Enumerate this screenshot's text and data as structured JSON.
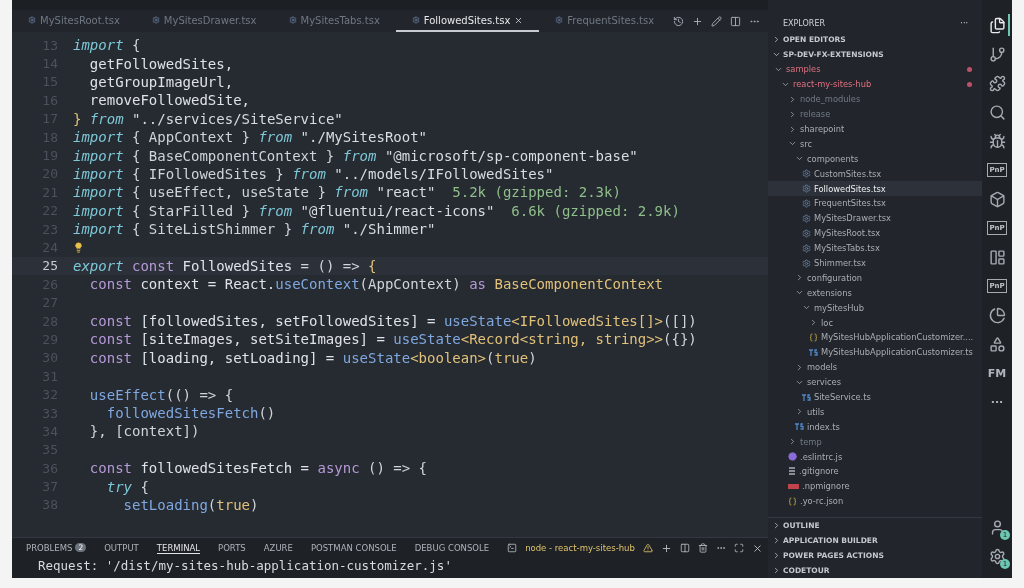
{
  "editor_tabs": [
    {
      "label": "MySitesRoot.tsx",
      "selected": false
    },
    {
      "label": "MySitesDrawer.tsx",
      "selected": false
    },
    {
      "label": "MySitesTabs.tsx",
      "selected": false
    },
    {
      "label": "FollowedSites.tsx",
      "selected": true
    },
    {
      "label": "FrequentSites.tsx",
      "selected": false
    }
  ],
  "code": {
    "lines": [
      {
        "number": "13",
        "tokens": [
          {
            "kind": "kw",
            "text": "import"
          },
          {
            "kind": "p",
            "text": " {"
          }
        ]
      },
      {
        "number": "14",
        "tokens": [
          {
            "kind": "v",
            "text": "  getFollowedSites,"
          }
        ]
      },
      {
        "number": "15",
        "tokens": [
          {
            "kind": "v",
            "text": "  getGroupImageUrl,"
          }
        ]
      },
      {
        "number": "16",
        "tokens": [
          {
            "kind": "v",
            "text": "  removeFollowedSite,"
          }
        ]
      },
      {
        "number": "17",
        "tokens": [
          {
            "kind": "t",
            "text": "}"
          },
          {
            "kind": "kw",
            "text": " from "
          },
          {
            "kind": "s",
            "text": "\"../services/SiteService\""
          }
        ]
      },
      {
        "number": "18",
        "tokens": [
          {
            "kind": "kw",
            "text": "import"
          },
          {
            "kind": "p",
            "text": " { AppContext } "
          },
          {
            "kind": "kw",
            "text": "from "
          },
          {
            "kind": "s",
            "text": "\"./MySitesRoot\""
          }
        ]
      },
      {
        "number": "19",
        "tokens": [
          {
            "kind": "kw",
            "text": "import"
          },
          {
            "kind": "p",
            "text": " { BaseComponentContext } "
          },
          {
            "kind": "kw",
            "text": "from "
          },
          {
            "kind": "s",
            "text": "\"@microsoft/sp-component-base\""
          }
        ]
      },
      {
        "number": "20",
        "tokens": [
          {
            "kind": "kw",
            "text": "import"
          },
          {
            "kind": "p",
            "text": " { IFollowedSites } "
          },
          {
            "kind": "kw",
            "text": "from "
          },
          {
            "kind": "s",
            "text": "\"../models/IFollowedSites\""
          }
        ]
      },
      {
        "number": "21",
        "tokens": [
          {
            "kind": "kw",
            "text": "import"
          },
          {
            "kind": "p",
            "text": " { useEffect, useState } "
          },
          {
            "kind": "kw",
            "text": "from "
          },
          {
            "kind": "s",
            "text": "\"react\""
          },
          {
            "kind": "h",
            "text": "  5.2k (gzipped: 2.3k)"
          }
        ]
      },
      {
        "number": "22",
        "tokens": [
          {
            "kind": "kw",
            "text": "import"
          },
          {
            "kind": "p",
            "text": " { StarFilled } "
          },
          {
            "kind": "kw",
            "text": "from "
          },
          {
            "kind": "s",
            "text": "\"@fluentui/react-icons\""
          },
          {
            "kind": "h",
            "text": "  6.6k (gzipped: 2.9k)"
          }
        ]
      },
      {
        "number": "23",
        "tokens": [
          {
            "kind": "kw",
            "text": "import"
          },
          {
            "kind": "p",
            "text": " { SiteListShimmer } "
          },
          {
            "kind": "kw",
            "text": "from "
          },
          {
            "kind": "s",
            "text": "\"./Shimmer\""
          }
        ]
      },
      {
        "number": "24",
        "lightbulb": true
      },
      {
        "number": "25",
        "current": true,
        "tokens": [
          {
            "kind": "kw",
            "text": "export "
          },
          {
            "kind": "c",
            "text": "const "
          },
          {
            "kind": "v",
            "text": "FollowedSites"
          },
          {
            "kind": "p",
            "text": " = () => "
          },
          {
            "kind": "t",
            "text": "{"
          }
        ]
      },
      {
        "number": "26",
        "tokens": [
          {
            "kind": "c",
            "text": "  const "
          },
          {
            "kind": "v",
            "text": "context = React."
          },
          {
            "kind": "f",
            "text": "useContext"
          },
          {
            "kind": "p",
            "text": "(AppContext) "
          },
          {
            "kind": "c",
            "text": "as "
          },
          {
            "kind": "t",
            "text": "BaseComponentContext"
          }
        ]
      },
      {
        "number": "27"
      },
      {
        "number": "28",
        "tokens": [
          {
            "kind": "c",
            "text": "  const "
          },
          {
            "kind": "v",
            "text": "[followedSites, setFollowedSites] = "
          },
          {
            "kind": "f",
            "text": "useState"
          },
          {
            "kind": "t",
            "text": "<IFollowedSites[]>"
          },
          {
            "kind": "p",
            "text": "([])"
          }
        ]
      },
      {
        "number": "29",
        "tokens": [
          {
            "kind": "c",
            "text": "  const "
          },
          {
            "kind": "v",
            "text": "[siteImages, setSiteImages] = "
          },
          {
            "kind": "f",
            "text": "useState"
          },
          {
            "kind": "t",
            "text": "<Record<string, string>>"
          },
          {
            "kind": "p",
            "text": "({})"
          }
        ]
      },
      {
        "number": "30",
        "tokens": [
          {
            "kind": "c",
            "text": "  const "
          },
          {
            "kind": "v",
            "text": "[loading, setLoading] = "
          },
          {
            "kind": "f",
            "text": "useState"
          },
          {
            "kind": "t",
            "text": "<boolean>"
          },
          {
            "kind": "p",
            "text": "("
          },
          {
            "kind": "t",
            "text": "true"
          },
          {
            "kind": "p",
            "text": ")"
          }
        ]
      },
      {
        "number": "31"
      },
      {
        "number": "32",
        "tokens": [
          {
            "kind": "f",
            "text": "  useEffect"
          },
          {
            "kind": "p",
            "text": "(() => {"
          }
        ]
      },
      {
        "number": "33",
        "tokens": [
          {
            "kind": "f",
            "text": "    followedSitesFetch"
          },
          {
            "kind": "p",
            "text": "()"
          }
        ]
      },
      {
        "number": "34",
        "tokens": [
          {
            "kind": "p",
            "text": "  }, [context])"
          }
        ]
      },
      {
        "number": "35"
      },
      {
        "number": "36",
        "tokens": [
          {
            "kind": "c",
            "text": "  const "
          },
          {
            "kind": "v",
            "text": "followedSitesFetch = "
          },
          {
            "kind": "c",
            "text": "async "
          },
          {
            "kind": "p",
            "text": "() => {"
          }
        ]
      },
      {
        "number": "37",
        "tokens": [
          {
            "kind": "kw",
            "text": "    try "
          },
          {
            "kind": "p",
            "text": "{"
          }
        ]
      },
      {
        "number": "38",
        "tokens": [
          {
            "kind": "f",
            "text": "      setLoading"
          },
          {
            "kind": "p",
            "text": "("
          },
          {
            "kind": "t",
            "text": "true"
          },
          {
            "kind": "p",
            "text": ")"
          }
        ]
      }
    ]
  },
  "editor_actions": [
    {
      "kind": "history"
    },
    {
      "kind": "add"
    },
    {
      "kind": "edit"
    },
    {
      "kind": "split"
    },
    {
      "kind": "more"
    }
  ],
  "panel": {
    "tabs": [
      {
        "label": "PROBLEMS",
        "badge": "2",
        "selected": false
      },
      {
        "label": "OUTPUT",
        "selected": false
      },
      {
        "label": "TERMINAL",
        "selected": true
      },
      {
        "label": "PORTS",
        "selected": false
      },
      {
        "label": "AZURE",
        "selected": false
      },
      {
        "label": "POSTMAN CONSOLE",
        "selected": false
      },
      {
        "label": "DEBUG CONSOLE",
        "selected": false
      }
    ],
    "terminal_name": "node - react-my-sites-hub",
    "output": "Request: '/dist/my-sites-hub-application-customizer.js'"
  },
  "explorer": {
    "title": "EXPLORER",
    "more": "···",
    "sections": [
      {
        "label": "OPEN EDITORS",
        "expanded": false
      },
      {
        "label": "SP-DEV-FX-EXTENSIONS",
        "expanded": true
      }
    ],
    "tree": [
      {
        "name": "samples",
        "kind": "folder",
        "expanded": true,
        "modified": true,
        "children": [
          {
            "name": "react-my-sites-hub",
            "kind": "folder",
            "expanded": true,
            "modified": true,
            "children": [
              {
                "name": "node_modules",
                "kind": "folder",
                "expanded": false,
                "dimmed": true
              },
              {
                "name": "release",
                "kind": "folder",
                "expanded": false,
                "dimmed": true
              },
              {
                "name": "sharepoint",
                "kind": "folder",
                "expanded": false
              },
              {
                "name": "src",
                "kind": "folder",
                "expanded": true,
                "children": [
                  {
                    "name": "components",
                    "kind": "folder",
                    "expanded": true,
                    "children": [
                      {
                        "name": "CustomSites.tsx",
                        "kind": "tsx",
                        "selected": false
                      },
                      {
                        "name": "FollowedSites.tsx",
                        "kind": "tsx",
                        "selected": true
                      },
                      {
                        "name": "FrequentSites.tsx",
                        "kind": "tsx",
                        "selected": false
                      },
                      {
                        "name": "MySitesDrawer.tsx",
                        "kind": "tsx",
                        "selected": false
                      },
                      {
                        "name": "MySitesRoot.tsx",
                        "kind": "tsx",
                        "selected": false
                      },
                      {
                        "name": "MySitesTabs.tsx",
                        "kind": "tsx",
                        "selected": false
                      },
                      {
                        "name": "Shimmer.tsx",
                        "kind": "tsx",
                        "selected": false
                      }
                    ]
                  },
                  {
                    "name": "configuration",
                    "kind": "folder",
                    "expanded": false
                  },
                  {
                    "name": "extensions",
                    "kind": "folder",
                    "expanded": true,
                    "children": [
                      {
                        "name": "mySitesHub",
                        "kind": "folder",
                        "expanded": true,
                        "children": [
                          {
                            "name": "loc",
                            "kind": "folder",
                            "expanded": false
                          },
                          {
                            "name": "MySitesHubApplicationCustomizer....",
                            "kind": "json",
                            "selected": false
                          },
                          {
                            "name": "MySitesHubApplicationCustomizer.ts",
                            "kind": "ts",
                            "selected": false
                          }
                        ]
                      }
                    ]
                  },
                  {
                    "name": "models",
                    "kind": "folder",
                    "expanded": false
                  },
                  {
                    "name": "services",
                    "kind": "folder",
                    "expanded": true,
                    "children": [
                      {
                        "name": "SiteService.ts",
                        "kind": "ts",
                        "selected": false
                      }
                    ]
                  },
                  {
                    "name": "utils",
                    "kind": "folder",
                    "expanded": false
                  },
                  {
                    "name": "index.ts",
                    "kind": "ts",
                    "selected": false
                  }
                ]
              },
              {
                "name": "temp",
                "kind": "folder",
                "expanded": false,
                "dimmed": true
              },
              {
                "name": ".eslintrc.js",
                "kind": "eslint",
                "selected": false
              },
              {
                "name": ".gitignore",
                "kind": "git",
                "selected": false
              },
              {
                "name": ".npmignore",
                "kind": "npm",
                "selected": false
              },
              {
                "name": ".yo-rc.json",
                "kind": "json",
                "selected": false
              }
            ]
          }
        ]
      }
    ],
    "bottom_sections": [
      "OUTLINE",
      "APPLICATION BUILDER",
      "POWER PAGES ACTIONS",
      "CODETOUR"
    ]
  },
  "activity_bar": [
    {
      "kind": "files",
      "selected": true
    },
    {
      "kind": "source-control",
      "selected": false
    },
    {
      "kind": "extensions",
      "selected": false
    },
    {
      "kind": "search",
      "selected": false
    },
    {
      "kind": "debug",
      "selected": false
    },
    {
      "kind": "badge",
      "label": "PnP",
      "selected": false
    },
    {
      "kind": "cube",
      "selected": false
    },
    {
      "kind": "badge",
      "label": "PnP",
      "selected": false
    },
    {
      "kind": "board",
      "selected": false
    },
    {
      "kind": "badge",
      "label": "PnP",
      "selected": false
    },
    {
      "kind": "pie",
      "selected": false
    },
    {
      "kind": "shapes",
      "selected": false
    },
    {
      "kind": "text",
      "label": "FM",
      "selected": false
    },
    {
      "kind": "more",
      "label": "···",
      "selected": false
    }
  ],
  "activity_bottom": [
    {
      "kind": "account",
      "badge": "1"
    },
    {
      "kind": "settings",
      "badge": "1"
    }
  ]
}
